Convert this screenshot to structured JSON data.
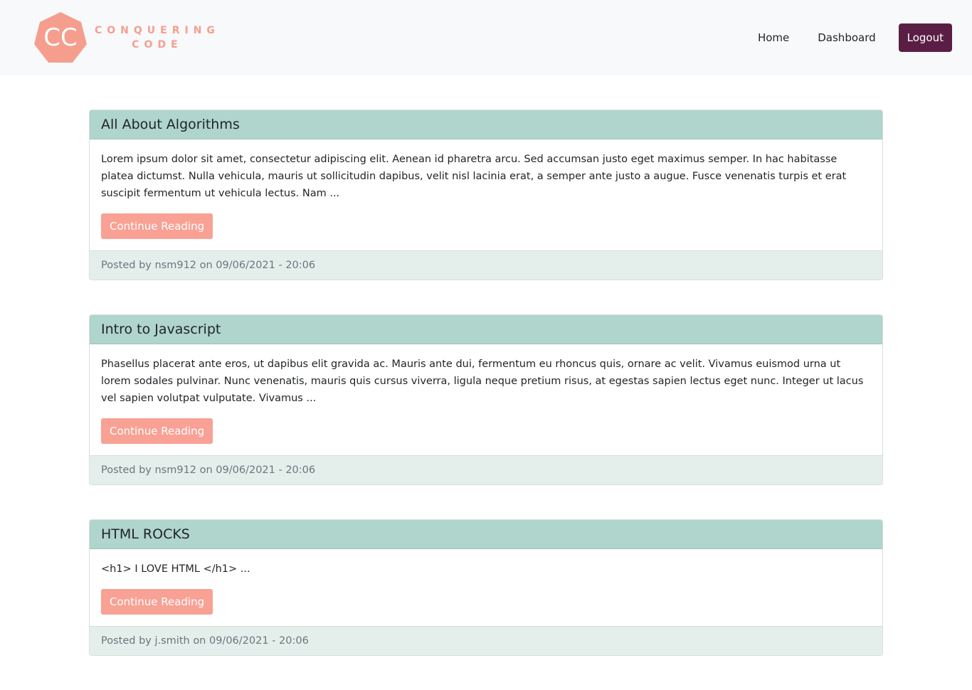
{
  "brand": {
    "initials": "CC",
    "line1": "CONQUERING",
    "line2": "CODE",
    "badge_color": "#f59e8e"
  },
  "nav": {
    "home": "Home",
    "dashboard": "Dashboard",
    "logout": "Logout"
  },
  "posts": [
    {
      "title": "All About Algorithms",
      "excerpt": "Lorem ipsum dolor sit amet, consectetur adipiscing elit. Aenean id pharetra arcu. Sed accumsan justo eget maximus semper. In hac habitasse platea dictumst. Nulla vehicula, mauris ut sollicitudin dapibus, velit nisl lacinia erat, a semper ante justo a augue. Fusce venenatis turpis et erat suscipit fermentum ut vehicula lectus. Nam ...",
      "button": "Continue Reading",
      "posted_prefix": "Posted by",
      "author": "nsm912",
      "on_word": "on",
      "date": "09/06/2021 - 20:06"
    },
    {
      "title": "Intro to Javascript",
      "excerpt": "Phasellus placerat ante eros, ut dapibus elit gravida ac. Mauris ante dui, fermentum eu rhoncus quis, ornare ac velit. Vivamus euismod urna ut lorem sodales pulvinar. Nunc venenatis, mauris quis cursus viverra, ligula neque pretium risus, at egestas sapien lectus eget nunc. Integer ut lacus vel sapien volutpat vulputate. Vivamus ...",
      "button": "Continue Reading",
      "posted_prefix": "Posted by",
      "author": "nsm912",
      "on_word": "on",
      "date": "09/06/2021 - 20:06"
    },
    {
      "title": "HTML ROCKS",
      "excerpt": "<h1> I LOVE HTML </h1> ...",
      "button": "Continue Reading",
      "posted_prefix": "Posted by",
      "author": "j.smith",
      "on_word": "on",
      "date": "09/06/2021 - 20:06"
    }
  ]
}
